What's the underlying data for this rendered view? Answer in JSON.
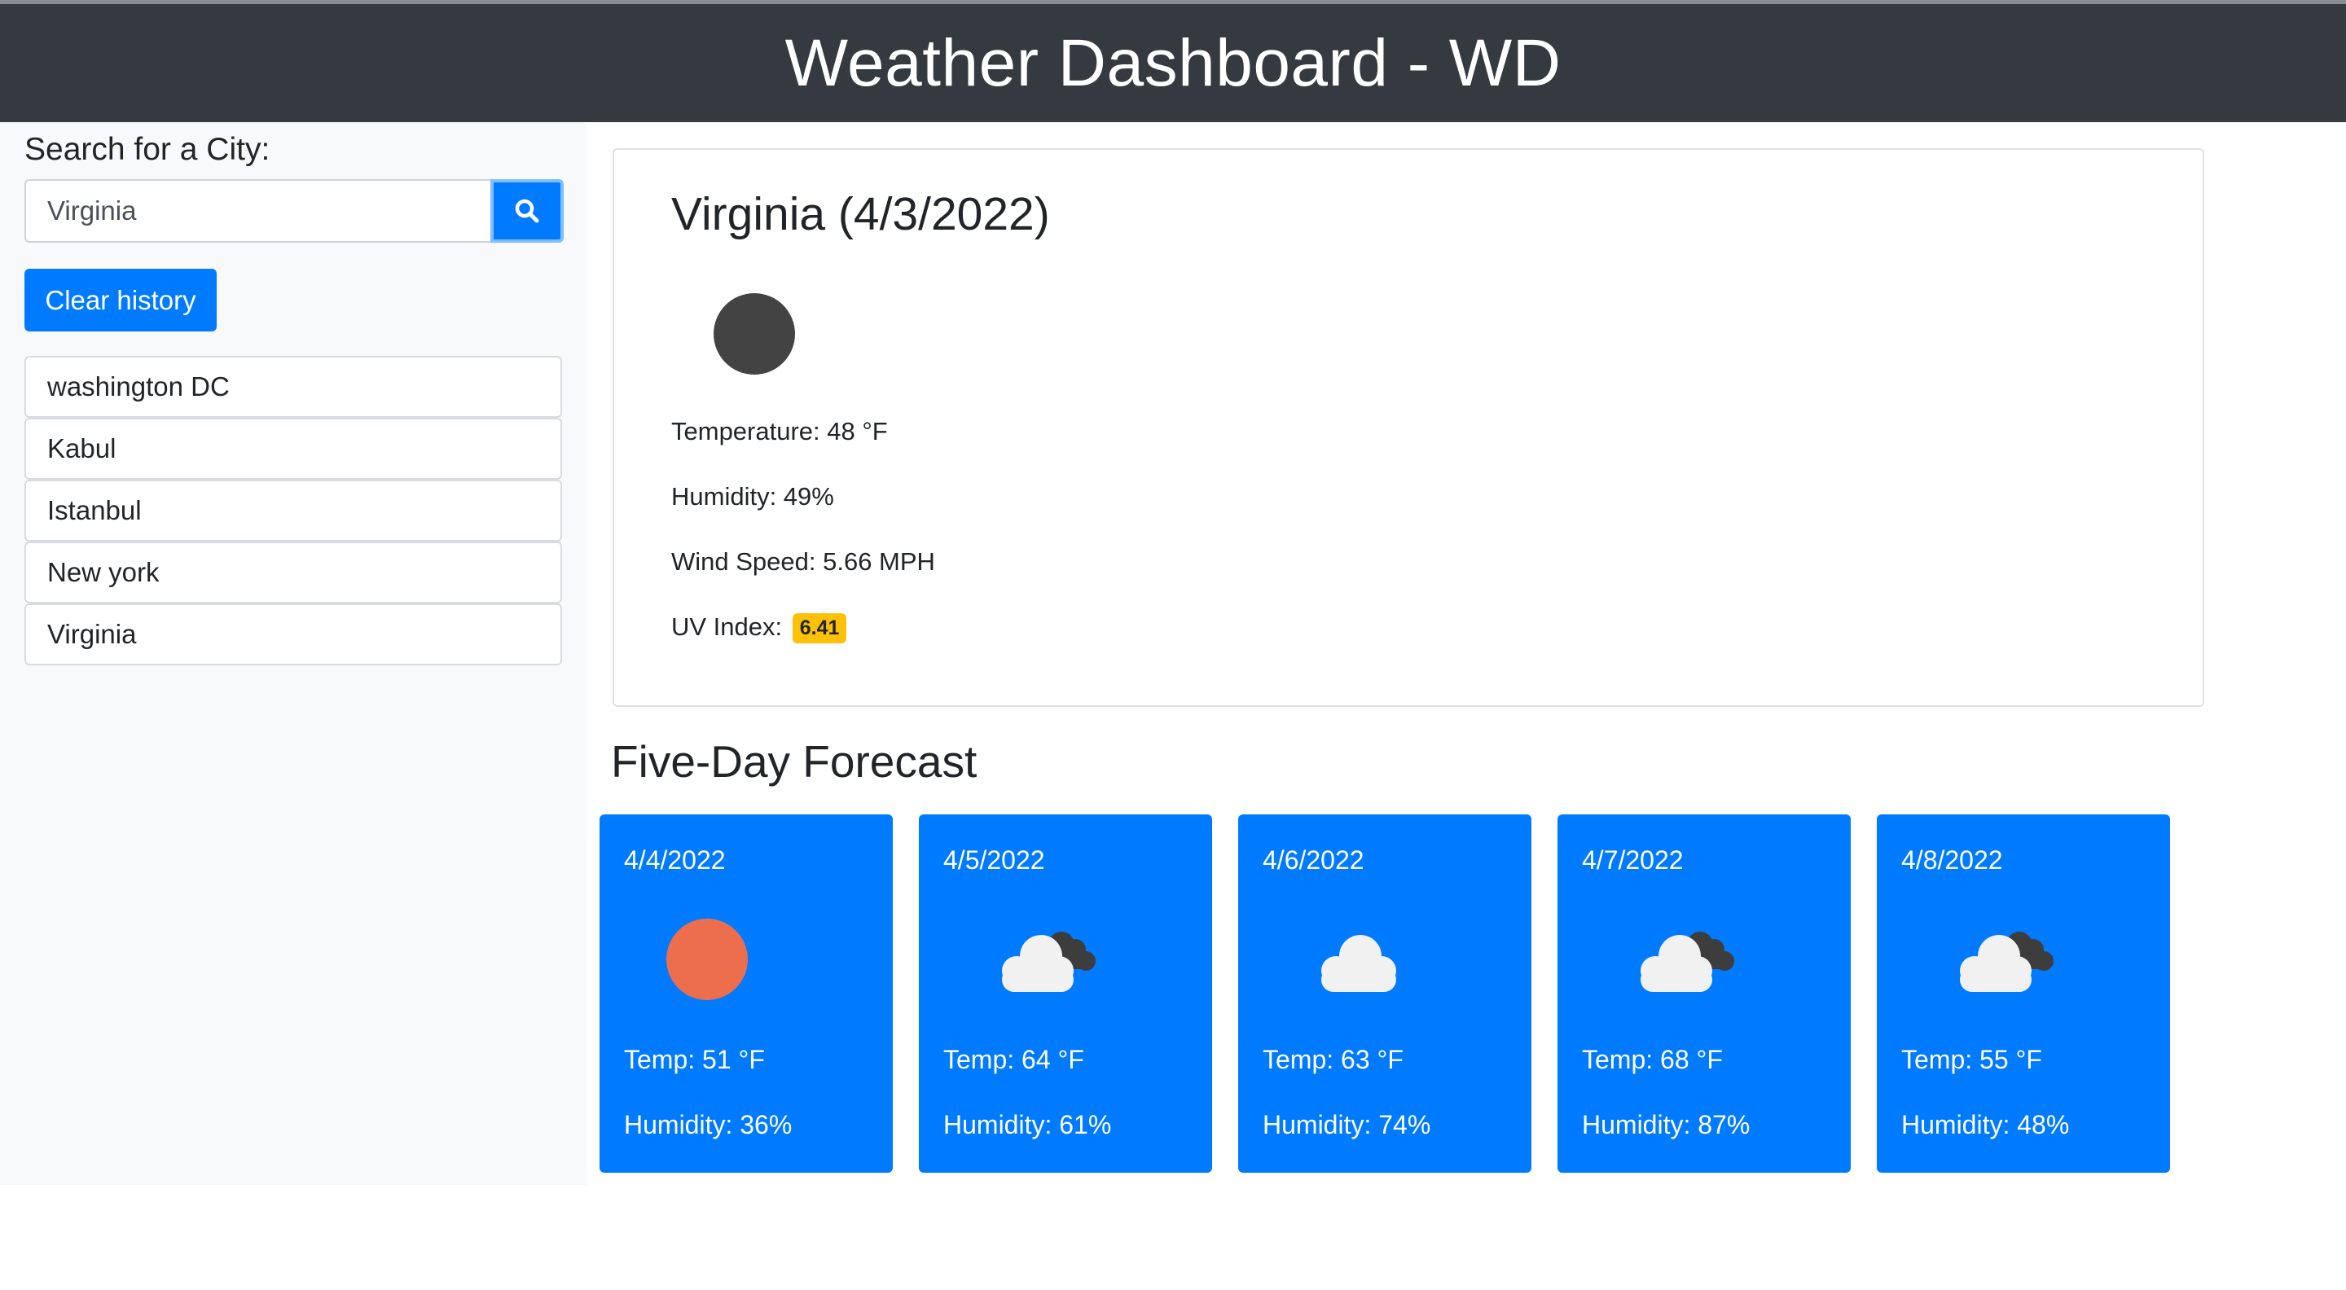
{
  "header": {
    "title": "Weather Dashboard - WD"
  },
  "sidebar": {
    "search_label": "Search for a City:",
    "search_value": "Virginia",
    "clear_label": "Clear history",
    "history": [
      "washington DC",
      "Kabul",
      "Istanbul",
      "New york",
      "Virginia"
    ]
  },
  "current": {
    "heading": "Virginia (4/3/2022)",
    "icon": "dark-moon-icon",
    "temperature": "Temperature: 48 °F",
    "humidity": "Humidity: 49%",
    "wind": "Wind Speed: 5.66 MPH",
    "uv_label": "UV Index:",
    "uv_value": "6.41",
    "uv_color": "#ffc107"
  },
  "forecast": {
    "title": "Five-Day Forecast",
    "days": [
      {
        "date": "4/4/2022",
        "icon": "sun-icon",
        "temp": "Temp: 51 °F",
        "humidity": "Humidity: 36%"
      },
      {
        "date": "4/5/2022",
        "icon": "broken-clouds-icon",
        "temp": "Temp: 64 °F",
        "humidity": "Humidity: 61%"
      },
      {
        "date": "4/6/2022",
        "icon": "cloud-icon",
        "temp": "Temp: 63 °F",
        "humidity": "Humidity: 74%"
      },
      {
        "date": "4/7/2022",
        "icon": "broken-clouds-icon",
        "temp": "Temp: 68 °F",
        "humidity": "Humidity: 87%"
      },
      {
        "date": "4/8/2022",
        "icon": "broken-clouds-icon",
        "temp": "Temp: 55 °F",
        "humidity": "Humidity: 48%"
      }
    ]
  },
  "colors": {
    "primary": "#007bff",
    "header_bg": "#343a40",
    "sun": "#ec6e4c"
  }
}
